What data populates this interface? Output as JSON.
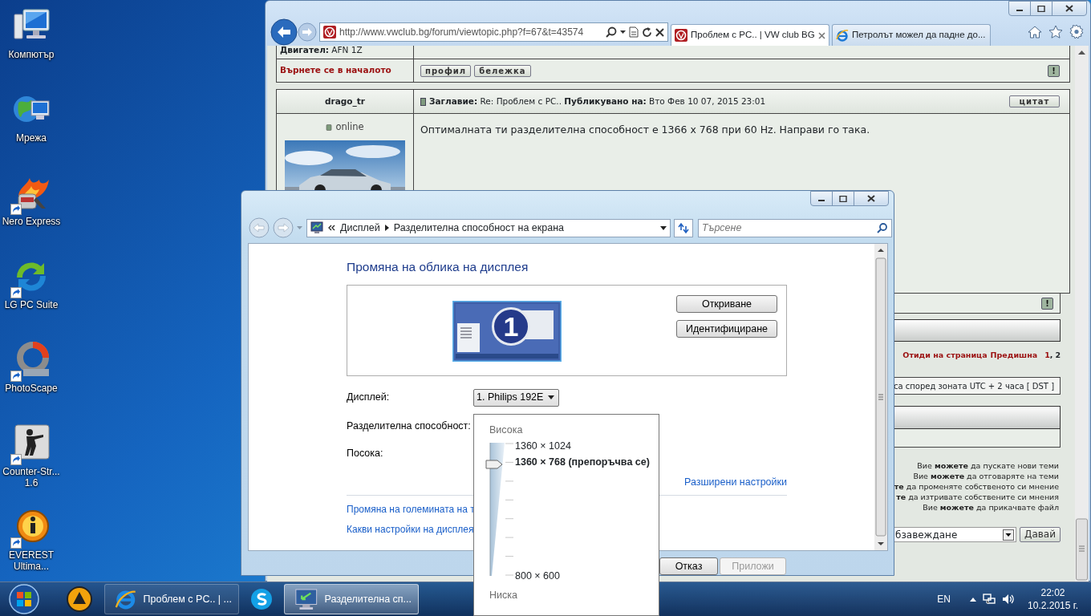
{
  "desktop_icons": [
    {
      "label": "Компютър",
      "kind": "computer",
      "shortcut": false
    },
    {
      "label": "Мрежа",
      "kind": "network",
      "shortcut": false
    },
    {
      "label": "Nero Express",
      "kind": "flame",
      "shortcut": true
    },
    {
      "label": "LG PC Suite",
      "kind": "sync",
      "shortcut": true
    },
    {
      "label": "PhotoScape",
      "kind": "ring",
      "shortcut": true
    },
    {
      "label": "Counter-Str... 1.6",
      "kind": "game",
      "shortcut": true
    },
    {
      "label": "EVEREST Ultima...",
      "kind": "info",
      "shortcut": true
    }
  ],
  "browser": {
    "address": "http://www.vwclub.bg/forum/viewtopic.php?f=67&t=43574",
    "tabs": [
      {
        "title": "Проблем с PC.. | VW club BG",
        "selected": true,
        "kind": "site"
      },
      {
        "title": "Петролът можел да падне до...",
        "selected": false,
        "kind": "ie"
      }
    ],
    "forum": {
      "profile_field": "**Двигател:** AFN 1Z",
      "back_to_top": "Върнете се в началото",
      "profile_buttons": [
        "профил",
        "бележка"
      ],
      "report_button": "!",
      "post": {
        "author": "drago_tr",
        "header": "**Заглавие:** Re: Проблем с PC.. **Публикувано на:** Вто Фев 10 07, 2015 23:01",
        "quote_button": "цитат",
        "status": "online",
        "online": true,
        "body": "Оптималната ти разделителна способност е 1366 x 768 при 60 Hz. Направи го така.",
        "report_button": "!"
      },
      "pagination": {
        "label": "Отиди на страница",
        "previous": "Предишна",
        "separator": ",",
        "pages": [
          {
            "label": "1",
            "selected": false
          },
          {
            "label": "2",
            "selected": true
          }
        ]
      },
      "timezone": "са според зоната UTC + 2 часа [ DST ]",
      "permissions": [
        "Вие **можете** да пускате нови теми",
        "Вие **можете** да отговаряте на теми",
        "**те** да променяте собственото си мнение",
        "**те** да изтривате собствените си мнения",
        "Вие **можете** да прикачвате файл"
      ],
      "jump_select": "бзавеждане",
      "go_button": "Давай"
    }
  },
  "dialog": {
    "breadcrumb": [
      "Дисплей",
      "Разделителна способност на екрана"
    ],
    "search_placeholder": "Търсене",
    "heading": "Промяна на облика на дисплея",
    "monitor_number": "1",
    "preview_buttons": [
      "Откриване",
      "Идентифициране"
    ],
    "fields": [
      {
        "label": "Дисплей:",
        "value": "1. Philips 192E"
      },
      {
        "label": "Разделителна способност:"
      },
      {
        "label": "Посока:"
      }
    ],
    "advanced_link": "Разширени настройки",
    "links": [
      "Промяна на големината на т",
      "Какви настройки на дисплея"
    ],
    "footer_buttons": [
      {
        "label": "Отказ",
        "disabled": false
      },
      {
        "label": "Приложи",
        "disabled": true
      }
    ]
  },
  "resolution_popup": {
    "high": "Висока",
    "low": "Ниска",
    "level": 0.85,
    "options": [
      {
        "label": "1360 × 1024",
        "selected": false
      },
      {
        "label": "1360 × 768 (препоръчва се)",
        "selected": true
      },
      {
        "label": "800 × 600",
        "selected": false
      }
    ]
  },
  "taskbar": {
    "items": [
      {
        "kind": "player",
        "selected": false
      },
      {
        "kind": "browser",
        "label": "Проблем с PC.. | ...",
        "selected": false
      },
      {
        "kind": "chat",
        "selected": false
      },
      {
        "kind": "display",
        "label": "Разделителна сп...",
        "selected": true
      }
    ],
    "language": "EN",
    "time": "22:02",
    "date": "10.2.2015 г."
  }
}
